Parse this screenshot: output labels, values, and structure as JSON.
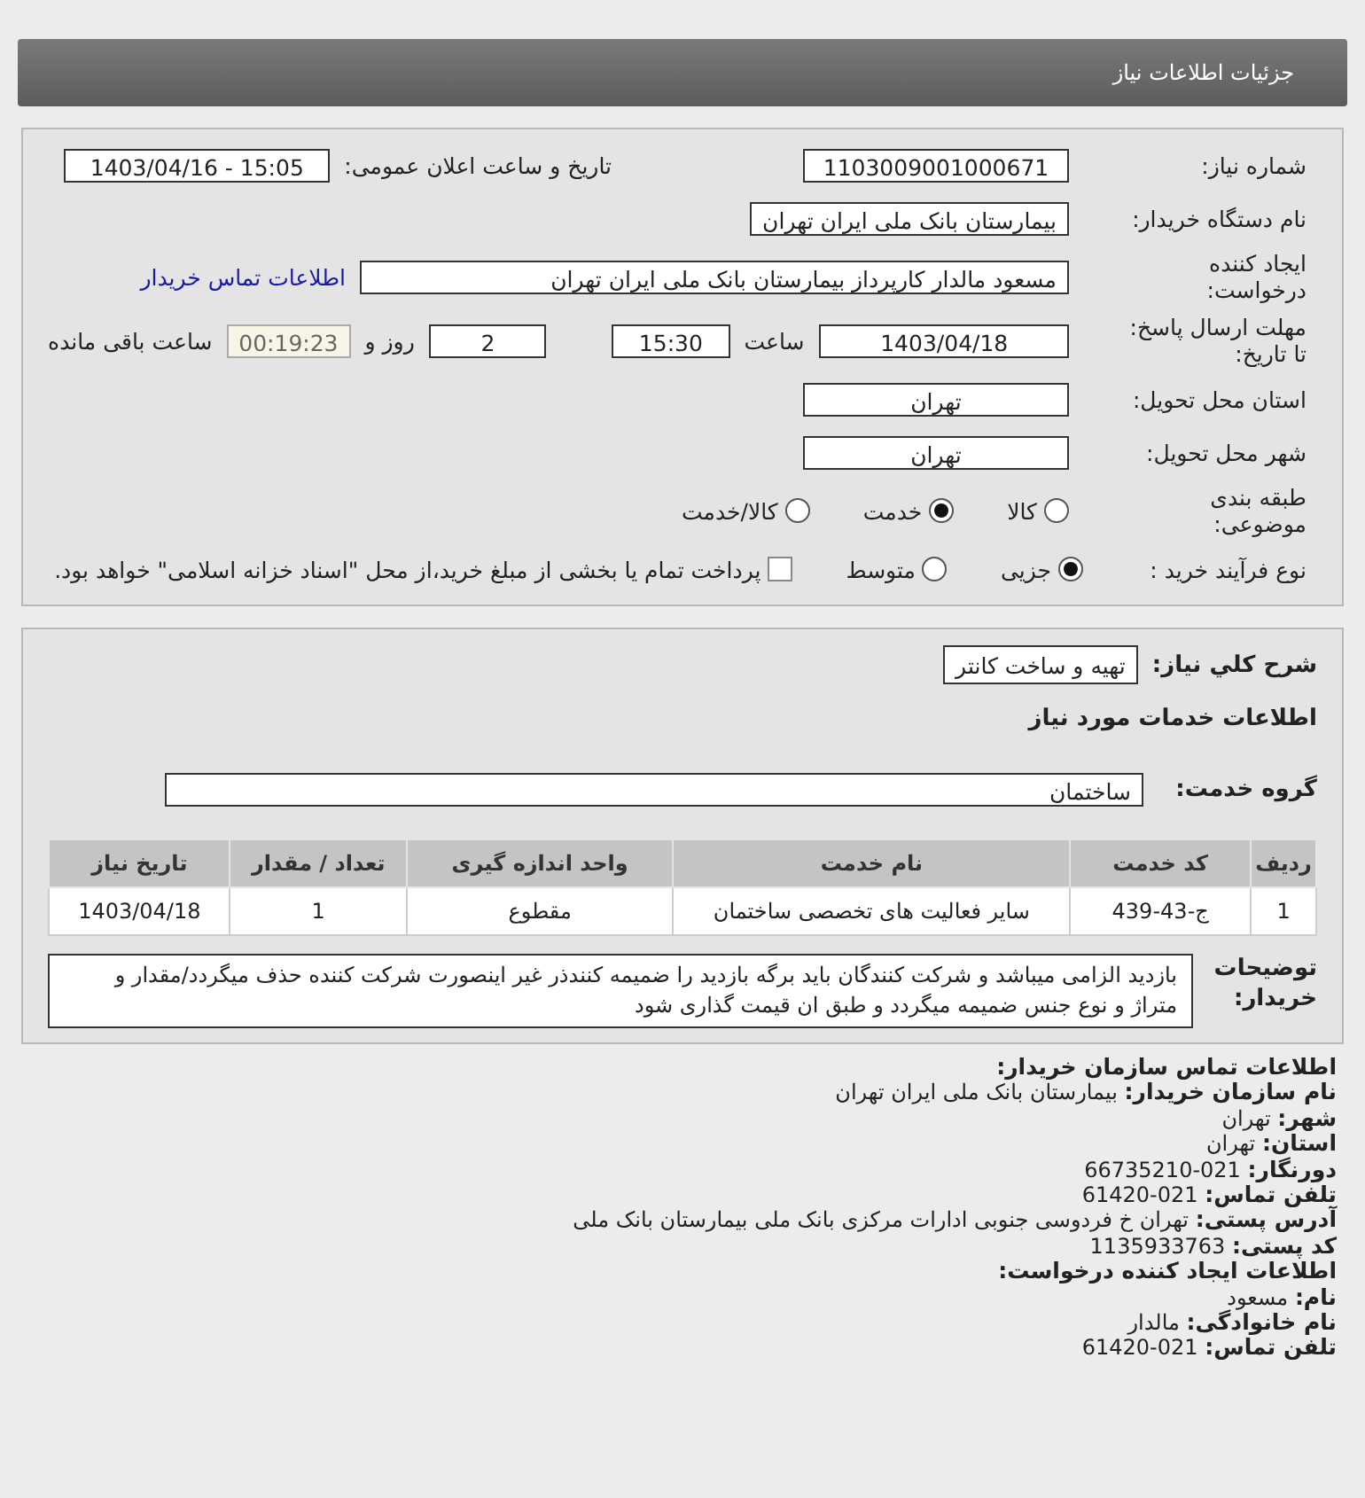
{
  "header": {
    "title": "جزئیات اطلاعات نیاز"
  },
  "summary": {
    "need_number": {
      "label": "شماره نیاز:",
      "value": "1103009001000671"
    },
    "announce": {
      "label": "تاریخ و ساعت اعلان عمومی:",
      "value": "1403/04/16 - 15:05"
    },
    "buyer_org": {
      "label": "نام دستگاه خریدار:",
      "value": "بیمارستان بانک ملی ایران تهران"
    },
    "requester": {
      "label": "ایجاد کننده درخواست:",
      "value": "مسعود مالدار کارپرداز بیمارستان بانک ملی ایران تهران",
      "link": "اطلاعات تماس خریدار"
    },
    "deadline": {
      "label": "مهلت ارسال پاسخ: تا تاریخ:",
      "date": "1403/04/18",
      "time_label": "ساعت",
      "time": "15:30",
      "days": "2",
      "days_label": "روز و",
      "remaining": "00:19:23",
      "remaining_label": "ساعت باقی مانده"
    },
    "province": {
      "label": "استان محل تحویل:",
      "value": "تهران"
    },
    "city": {
      "label": "شهر محل تحویل:",
      "value": "تهران"
    },
    "category": {
      "label": "طبقه بندی موضوعی:",
      "options": [
        {
          "label": "کالا",
          "selected": false
        },
        {
          "label": "خدمت",
          "selected": true
        },
        {
          "label": "کالا/خدمت",
          "selected": false
        }
      ]
    },
    "process": {
      "label": "نوع فرآیند خرید :",
      "options": [
        {
          "label": "جزیی",
          "selected": true
        },
        {
          "label": "متوسط",
          "selected": false
        }
      ],
      "payment": {
        "label": "پرداخت تمام یا بخشی از مبلغ خرید،از محل \"اسناد خزانه اسلامی\" خواهد بود.",
        "checked": false
      }
    }
  },
  "details": {
    "description": {
      "label": "شرح کلي نياز:",
      "value": "تهیه و ساخت کانتر"
    },
    "services_title": "اطلاعات خدمات مورد نیاز",
    "service_group": {
      "label": "گروه خدمت:",
      "value": "ساختمان"
    },
    "table": {
      "columns": [
        "ردیف",
        "کد خدمت",
        "نام خدمت",
        "واحد اندازه گیری",
        "تعداد / مقدار",
        "تاریخ نیاز"
      ],
      "rows": [
        [
          "1",
          "ج-43-439",
          "سایر فعالیت های تخصصی ساختمان",
          "مقطوع",
          "1",
          "1403/04/18"
        ]
      ]
    },
    "notes": {
      "label": "توضیحات خریدار:",
      "value": "بازدید الزامی میباشد و شرکت کنندگان باید برگه بازدید را ضمیمه کنندذر غیر اینصورت شرکت کننده حذف میگردد/مقدار و متراژ و نوع جنس ضمیمه میگردد و طبق ان قیمت گذاری شود"
    }
  },
  "contact": [
    {
      "kind": "heading",
      "label": "اطلاعات تماس سازمان خریدار:"
    },
    {
      "kind": "field",
      "label": "نام سازمان خریدار:",
      "value": "بیمارستان بانک ملی ایران تهران"
    },
    {
      "kind": "field",
      "label": "شهر:",
      "value": "تهران"
    },
    {
      "kind": "field",
      "label": "استان:",
      "value": "تهران"
    },
    {
      "kind": "field",
      "label": "دورنگار:",
      "value": "66735210-021"
    },
    {
      "kind": "field",
      "label": "تلفن تماس:",
      "value": "61420-021"
    },
    {
      "kind": "field",
      "label": "آدرس پستی:",
      "value": "تهران خ فردوسی جنوبی ادارات مرکزی بانک ملی بیمارستان بانک ملی"
    },
    {
      "kind": "field",
      "label": "کد پستی:",
      "value": "1135933763"
    },
    {
      "kind": "heading",
      "label": "اطلاعات ایجاد کننده درخواست:"
    },
    {
      "kind": "field",
      "label": "نام:",
      "value": "مسعود"
    },
    {
      "kind": "field",
      "label": "نام خانوادگی:",
      "value": "مالدار"
    },
    {
      "kind": "field",
      "label": "تلفن تماس:",
      "value": "61420-021"
    }
  ]
}
